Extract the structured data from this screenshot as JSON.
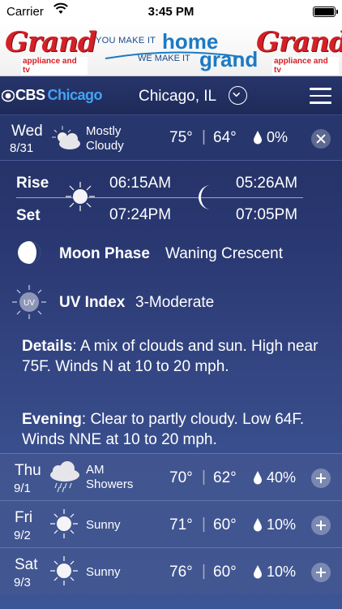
{
  "status_bar": {
    "carrier": "Carrier",
    "time": "3:45 PM"
  },
  "ad": {
    "left_logo": "Grand",
    "left_sub": "appliance and tv",
    "tag_top": "YOU MAKE IT",
    "tag_home": "home",
    "tag_bot": "WE MAKE IT",
    "tag_grand": "grand",
    "right_logo": "Grand",
    "right_sub": "appliance and tv"
  },
  "nav": {
    "brand": "CBS",
    "city": "Chicago",
    "location": "Chicago, IL"
  },
  "today": {
    "dow": "Wed",
    "date": "8/31",
    "condition": "Mostly Cloudy",
    "icon": "partly-cloudy-icon",
    "hi": "75°",
    "sep": "|",
    "lo": "64°",
    "precip": "0%"
  },
  "detail": {
    "rise_label": "Rise",
    "set_label": "Set",
    "sunrise": "06:15AM",
    "sunset": "07:24PM",
    "moonrise": "05:26AM",
    "moonset": "07:05PM",
    "moon_phase_label": "Moon Phase",
    "moon_phase": "Waning Crescent",
    "uv_label": "UV Index",
    "uv_value": "3-Moderate",
    "uv_icon_text": "UV",
    "details_label": "Details",
    "details_text": ": A mix of clouds and sun. High near 75F. Winds N at 10 to 20 mph.",
    "evening_label": "Evening",
    "evening_text": ": Clear to partly cloudy. Low 64F. Winds NNE at 10 to 20 mph."
  },
  "forecast": [
    {
      "dow": "Thu",
      "date": "9/1",
      "condition": "AM Showers",
      "icon": "showers-icon",
      "hi": "70°",
      "sep": "|",
      "lo": "62°",
      "precip": "40%"
    },
    {
      "dow": "Fri",
      "date": "9/2",
      "condition": "Sunny",
      "icon": "sun-icon",
      "hi": "71°",
      "sep": "|",
      "lo": "60°",
      "precip": "10%"
    },
    {
      "dow": "Sat",
      "date": "9/3",
      "condition": "Sunny",
      "icon": "sun-icon",
      "hi": "76°",
      "sep": "|",
      "lo": "60°",
      "precip": "10%"
    }
  ]
}
